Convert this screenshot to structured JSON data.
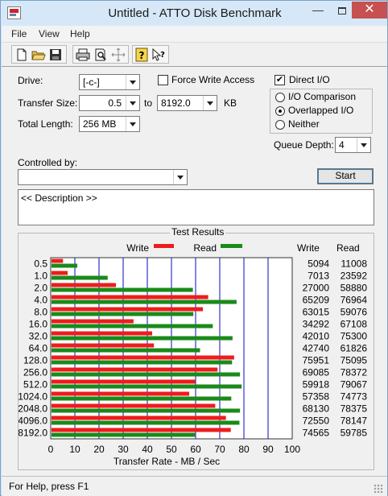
{
  "window": {
    "title": "Untitled - ATTO Disk Benchmark",
    "close_glyph": "✕",
    "minimize_glyph": "—"
  },
  "menu": [
    "File",
    "View",
    "Help"
  ],
  "toolbar": {
    "icons": [
      "new-icon",
      "open-icon",
      "save-icon",
      "print-icon",
      "print-preview-icon",
      "move-icon",
      "help-icon",
      "context-help-icon"
    ]
  },
  "form": {
    "drive_label": "Drive:",
    "drive_value": "[-c-]",
    "force_write_access_label": "Force Write Access",
    "force_write_access_checked": false,
    "direct_io_label": "Direct I/O",
    "direct_io_checked": true,
    "transfer_size_label": "Transfer Size:",
    "transfer_size_from": "0.5",
    "to_label": "to",
    "transfer_size_to": "8192.0",
    "kb_label": "KB",
    "total_length_label": "Total Length:",
    "total_length_value": "256 MB",
    "io_options": [
      {
        "label": "I/O Comparison",
        "selected": false
      },
      {
        "label": "Overlapped I/O",
        "selected": true
      },
      {
        "label": "Neither",
        "selected": false
      }
    ],
    "queue_depth_label": "Queue Depth:",
    "queue_depth_value": "4",
    "controlled_by_label": "Controlled by:",
    "controlled_by_value": "",
    "start_label": "Start",
    "description": "<< Description >>"
  },
  "results": {
    "title": "Test Results",
    "write_legend": "Write",
    "read_legend": "Read",
    "write_col": "Write",
    "read_col": "Read",
    "write_color": "#ee1c1c",
    "read_color": "#1a8a1a",
    "grid_color": "#3333cc"
  },
  "chart_data": {
    "type": "bar",
    "orientation": "horizontal",
    "categories": [
      "0.5",
      "1.0",
      "2.0",
      "4.0",
      "8.0",
      "16.0",
      "32.0",
      "64.0",
      "128.0",
      "256.0",
      "512.0",
      "1024.0",
      "2048.0",
      "4096.0",
      "8192.0"
    ],
    "series": [
      {
        "name": "Write",
        "values": [
          5094,
          7013,
          27000,
          65209,
          63015,
          34292,
          42010,
          42740,
          75951,
          69085,
          59918,
          57358,
          68130,
          72550,
          74565
        ]
      },
      {
        "name": "Read",
        "values": [
          11008,
          23592,
          58880,
          76964,
          59076,
          67108,
          75300,
          61826,
          75095,
          78372,
          79067,
          74773,
          78375,
          78147,
          59785
        ]
      }
    ],
    "xlabel": "Transfer Rate - MB / Sec",
    "xlim": [
      0,
      100
    ],
    "xticks": [
      "0",
      "10",
      "20",
      "30",
      "40",
      "50",
      "60",
      "70",
      "80",
      "90",
      "100"
    ],
    "grid": true,
    "legend": "top"
  },
  "status": {
    "text": "For Help, press F1"
  }
}
